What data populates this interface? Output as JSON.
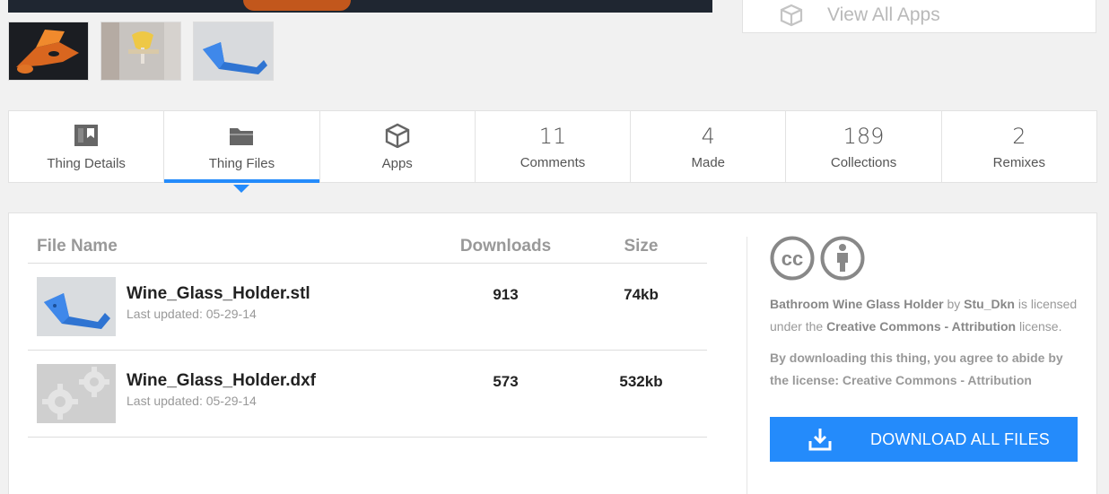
{
  "view_all_apps": {
    "label": "View All Apps",
    "icon": "cube-icon"
  },
  "tabs": [
    {
      "label": "Thing Details",
      "icon": "details-icon",
      "count": null,
      "active": false
    },
    {
      "label": "Thing Files",
      "icon": "folder-icon",
      "count": null,
      "active": true
    },
    {
      "label": "Apps",
      "icon": "cube-icon",
      "count": null,
      "active": false
    },
    {
      "label": "Comments",
      "count": "11"
    },
    {
      "label": "Made",
      "count": "4"
    },
    {
      "label": "Collections",
      "count": "189"
    },
    {
      "label": "Remixes",
      "count": "2"
    }
  ],
  "files_table": {
    "headers": {
      "name": "File Name",
      "downloads": "Downloads",
      "size": "Size"
    },
    "rows": [
      {
        "name": "Wine_Glass_Holder.stl",
        "updated": "Last updated: 05-29-14",
        "downloads": "913",
        "size": "74kb"
      },
      {
        "name": "Wine_Glass_Holder.dxf",
        "updated": "Last updated: 05-29-14",
        "downloads": "573",
        "size": "532kb"
      }
    ]
  },
  "license": {
    "thing_name": "Bathroom Wine Glass Holder",
    "by": "by",
    "author": "Stu_Dkn",
    "is_licensed": "is licensed under the",
    "license_name": "Creative Commons - Attribution",
    "license_suffix": "license.",
    "agree_text": "By downloading this thing, you agree to abide by the license: Creative Commons - Attribution",
    "download_button": "DOWNLOAD ALL FILES"
  },
  "colors": {
    "accent": "#248bfb",
    "hero": "#1f2631",
    "orange": "#c2571c"
  }
}
